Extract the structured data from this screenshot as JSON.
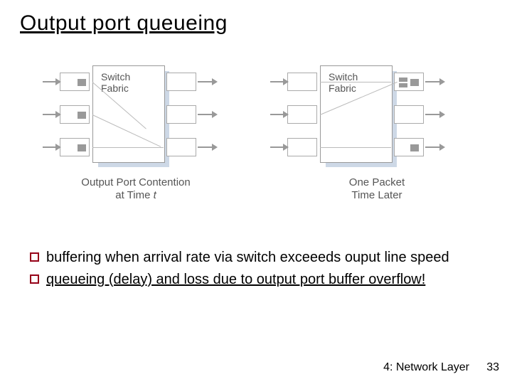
{
  "title": "Output port queueing",
  "diagram": {
    "switchLabel": "Switch\nFabric",
    "caption_left_line1": "Output Port Contention",
    "caption_left_line2_prefix": "at Time ",
    "caption_left_line2_var": "t",
    "caption_right_line1": "One Packet",
    "caption_right_line2": "Time Later"
  },
  "bullets": [
    {
      "pre": "buffering when arrival rate via switch exceeeds ouput line speed",
      "underline": ""
    },
    {
      "pre": "",
      "underline": "queueing (delay) and loss due to output port buffer overflow!"
    }
  ],
  "footer": "4: Network Layer",
  "page": "33"
}
